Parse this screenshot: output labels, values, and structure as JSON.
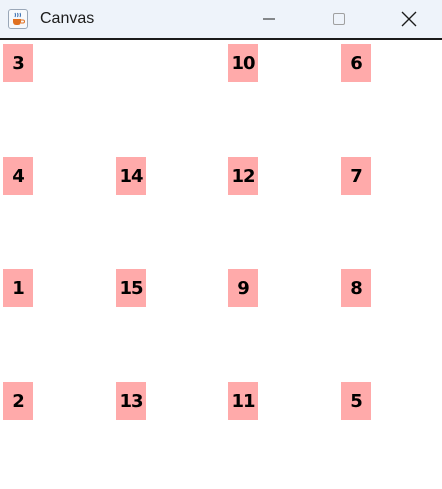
{
  "window": {
    "title": "Canvas",
    "icon": "java-cup-icon"
  },
  "controls": {
    "minimize": "minimize-icon",
    "maximize": "maximize-icon",
    "close": "close-icon"
  },
  "tile_color": "#ffaaaa",
  "grid": {
    "rows": [
      [
        "3",
        "",
        "10",
        "6"
      ],
      [
        "4",
        "14",
        "12",
        "7"
      ],
      [
        "1",
        "15",
        "9",
        "8"
      ],
      [
        "2",
        "13",
        "11",
        "5"
      ]
    ]
  }
}
